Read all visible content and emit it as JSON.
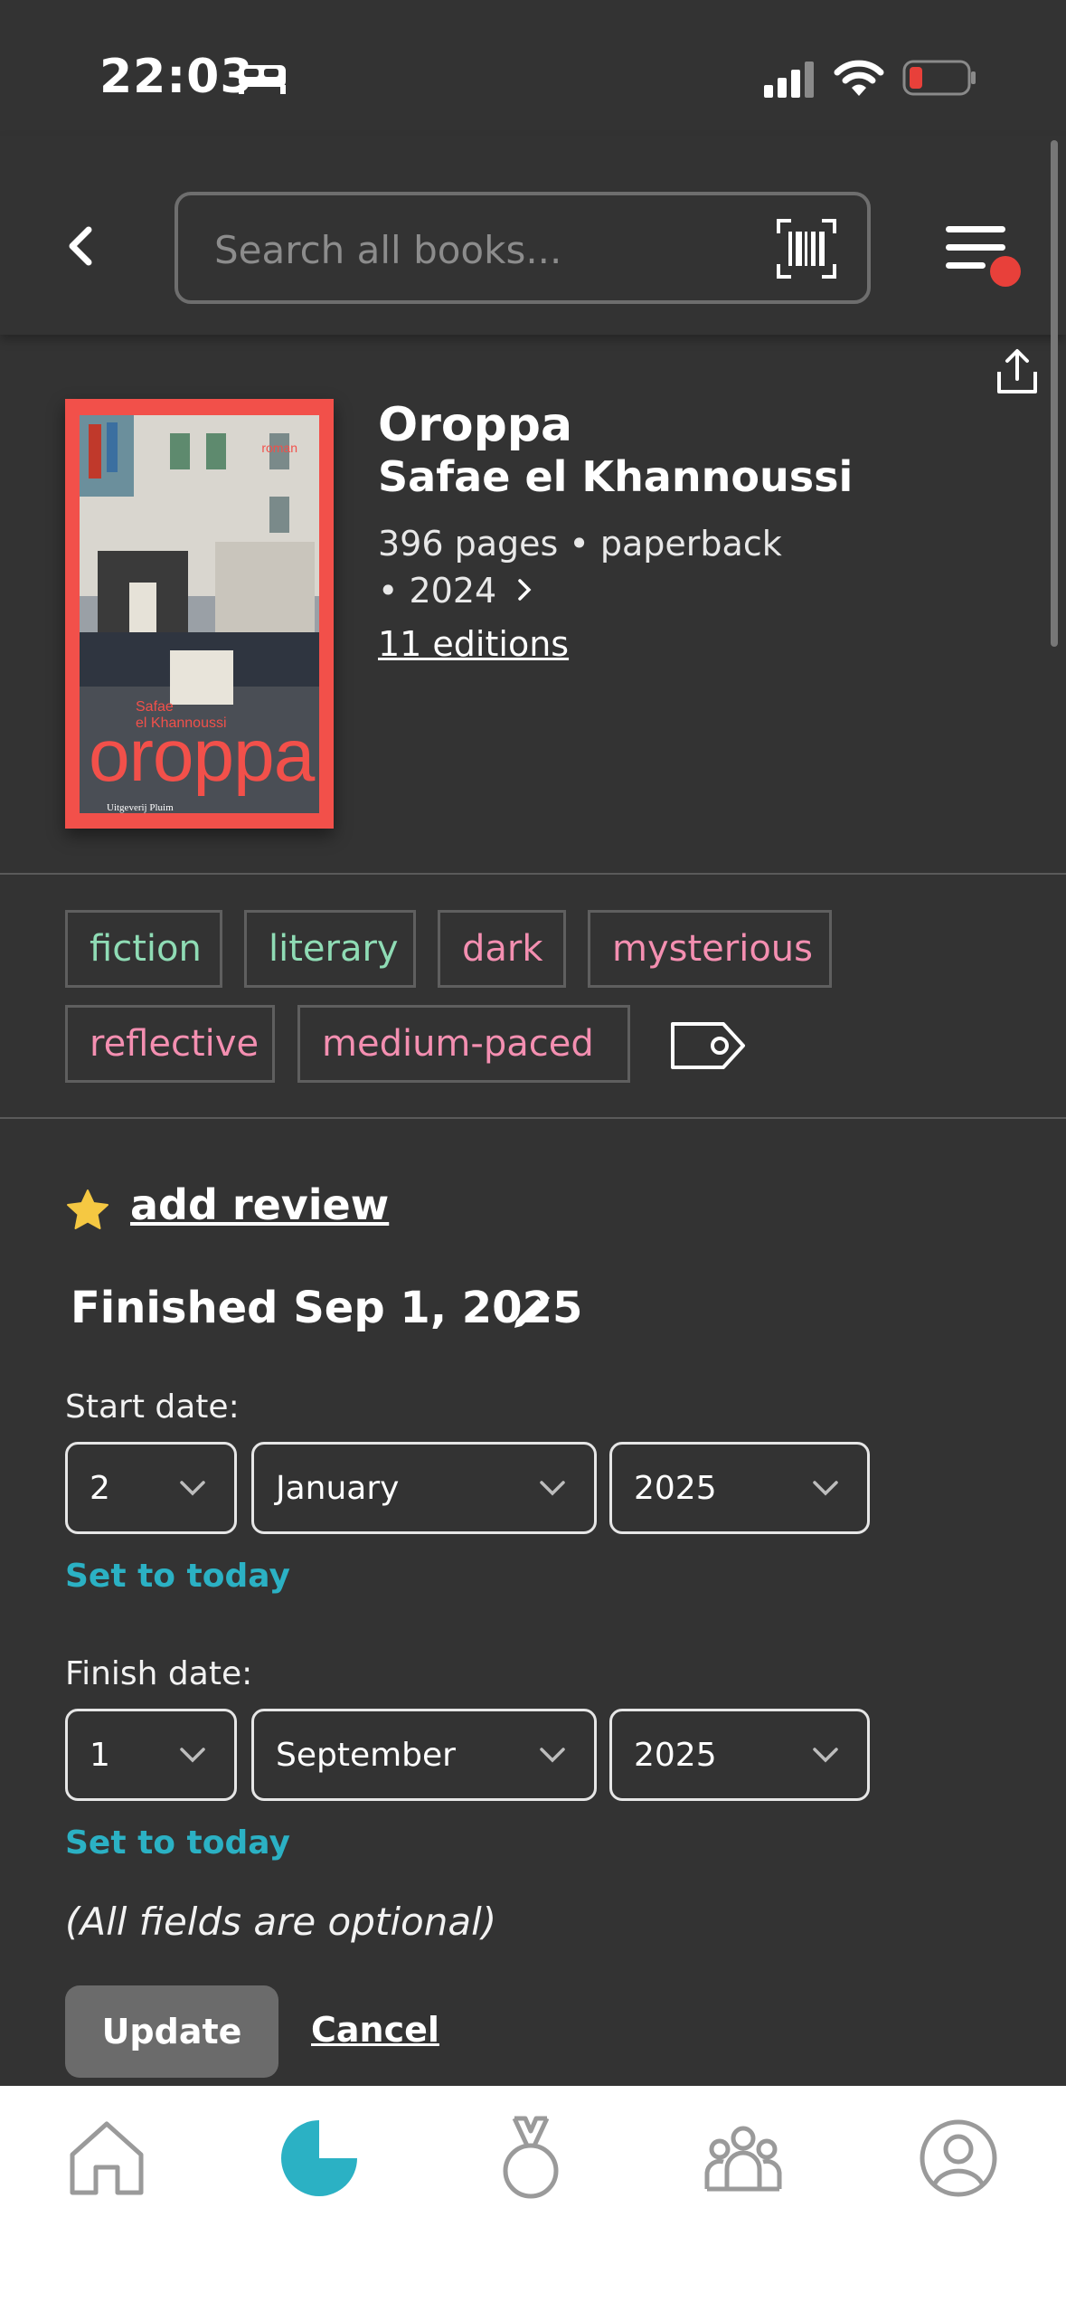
{
  "status_bar": {
    "time": "22:03"
  },
  "header": {
    "search_placeholder": "Search all books..."
  },
  "book": {
    "title": "Oroppa",
    "author": "Safae el Khannoussi",
    "pages_format": "396 pages • paperback",
    "year": "• 2024",
    "editions": "11 editions",
    "cover": {
      "label_roman": "roman",
      "label_author_line1": "Safae",
      "label_author_line2": "el Khannoussi",
      "label_title": "oroppa",
      "label_publisher": "Uitgeverij Pluim"
    }
  },
  "tags": [
    {
      "label": "fiction",
      "color": "#8fdcb5"
    },
    {
      "label": "literary",
      "color": "#8fdcb5"
    },
    {
      "label": "dark",
      "color": "#f48fb1"
    },
    {
      "label": "mysterious",
      "color": "#f48fb1"
    },
    {
      "label": "reflective",
      "color": "#f48fb1"
    },
    {
      "label": "medium-paced",
      "color": "#f48fb1"
    }
  ],
  "review": {
    "add_review_label": "add review",
    "finished_label": "Finished Sep 1, 2025"
  },
  "start_date": {
    "label": "Start date:",
    "day": "2",
    "month": "January",
    "year": "2025",
    "today_link": "Set to today"
  },
  "finish_date": {
    "label": "Finish date:",
    "day": "1",
    "month": "September",
    "year": "2025",
    "today_link": "Set to today"
  },
  "optional_note": "(All fields are optional)",
  "actions": {
    "update_label": "Update",
    "cancel_label": "Cancel"
  },
  "colors": {
    "accent_teal": "#2bb1c4",
    "cover_red": "#f2504a",
    "notification_red": "#e8403a",
    "star_yellow": "#f5c842"
  },
  "bottom_nav": [
    {
      "icon": "home-icon",
      "active": false
    },
    {
      "icon": "stats-pie-icon",
      "active": true
    },
    {
      "icon": "medal-icon",
      "active": false
    },
    {
      "icon": "community-icon",
      "active": false
    },
    {
      "icon": "profile-icon",
      "active": false
    }
  ]
}
